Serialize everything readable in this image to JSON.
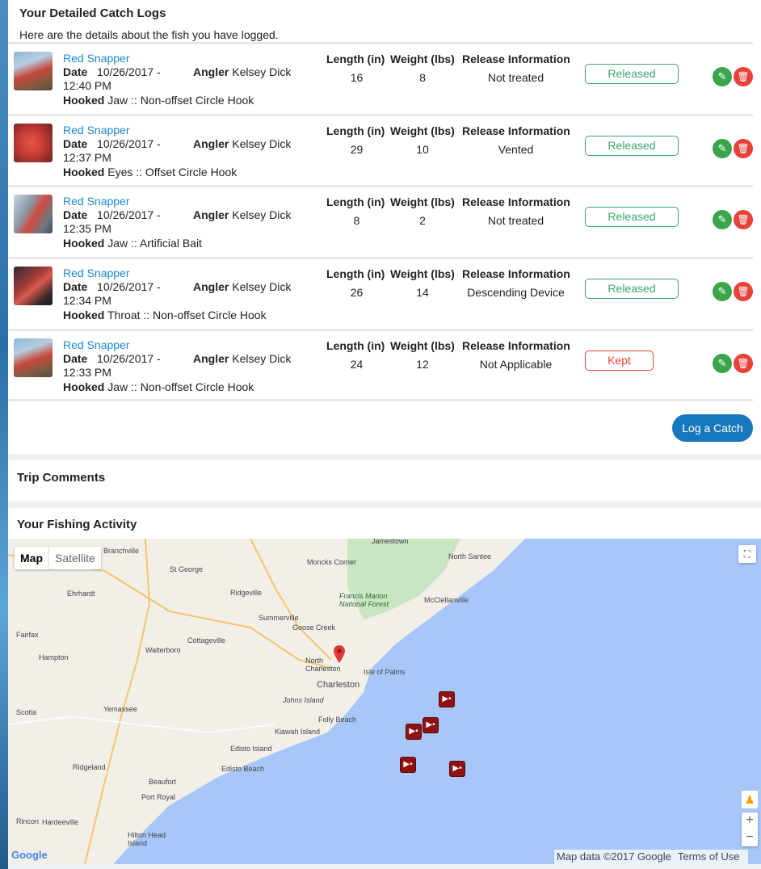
{
  "header": {
    "title": "Your Detailed Catch Logs",
    "subtitle": "Here are the details about the fish you have logged."
  },
  "labels": {
    "date": "Date",
    "angler": "Angler",
    "hooked": "Hooked",
    "length": "Length (in)",
    "weight": "Weight (lbs)",
    "release": "Release Information"
  },
  "catches": [
    {
      "species": "Red Snapper",
      "date": "10/26/2017 - 12:40 PM",
      "angler": "Kelsey Dick",
      "hooked": "Jaw :: Non-offset Circle Hook",
      "length": "16",
      "weight": "8",
      "release": "Not treated",
      "status": "Released"
    },
    {
      "species": "Red Snapper",
      "date": "10/26/2017 - 12:37 PM",
      "angler": "Kelsey Dick",
      "hooked": "Eyes :: Offset Circle Hook",
      "length": "29",
      "weight": "10",
      "release": "Vented",
      "status": "Released"
    },
    {
      "species": "Red Snapper",
      "date": "10/26/2017 - 12:35 PM",
      "angler": "Kelsey Dick",
      "hooked": "Jaw :: Artificial Bait",
      "length": "8",
      "weight": "2",
      "release": "Not treated",
      "status": "Released"
    },
    {
      "species": "Red Snapper",
      "date": "10/26/2017 - 12:34 PM",
      "angler": "Kelsey Dick",
      "hooked": "Throat :: Non-offset Circle Hook",
      "length": "26",
      "weight": "14",
      "release": "Descending Device",
      "status": "Released"
    },
    {
      "species": "Red Snapper",
      "date": "10/26/2017 - 12:33 PM",
      "angler": "Kelsey Dick",
      "hooked": "Jaw :: Non-offset Circle Hook",
      "length": "24",
      "weight": "12",
      "release": "Not Applicable",
      "status": "Kept"
    }
  ],
  "actions": {
    "log_catch": "Log a Catch",
    "edit_icon": "pencil-icon",
    "delete_icon": "trash-icon"
  },
  "sections": {
    "trip_comments": "Trip Comments",
    "fishing_activity": "Your Fishing Activity"
  },
  "map": {
    "type_map": "Map",
    "type_satellite": "Satellite",
    "attribution": "Map data ©2017 Google",
    "terms": "Terms of Use",
    "google": "Google",
    "places": [
      "Branchville",
      "Jamestown",
      "St George",
      "Moncks Corner",
      "North Santee",
      "Ridgeville",
      "Ehrhardt",
      "Francis Marion National Forest",
      "McClellanville",
      "Summerville",
      "Goose Creek",
      "Cottageville",
      "Walterboro",
      "Hampton",
      "Fairfax",
      "North Charleston",
      "Isle of Palms",
      "Charleston",
      "Johns Island",
      "Yemassee",
      "Folly Beach",
      "Kiawah Island",
      "Scotia",
      "Edisto Island",
      "Ridgeland",
      "Edisto Beach",
      "Beaufort",
      "Port Royal",
      "Rincon",
      "Hardeeville",
      "Hilton Head Island"
    ]
  },
  "colors": {
    "link": "#1e88d3",
    "released": "#3aa76d",
    "kept": "#e8413a",
    "edit": "#3aa54a",
    "primary": "#1677bd",
    "marker": "#8e1212"
  }
}
